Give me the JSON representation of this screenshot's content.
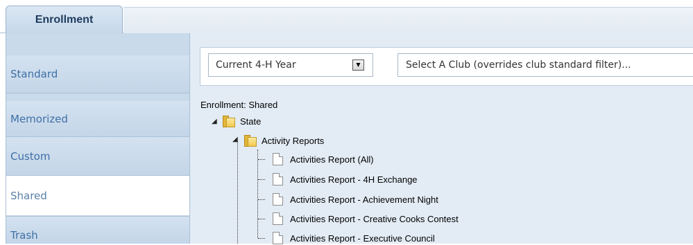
{
  "tabs": [
    {
      "label": "Enrollment",
      "active": true
    }
  ],
  "sidebar": {
    "items": [
      {
        "label": "Standard",
        "active": false
      },
      {
        "label": "Memorized",
        "active": false
      },
      {
        "label": "Custom",
        "active": false
      },
      {
        "label": "Shared",
        "active": true
      },
      {
        "label": "Trash",
        "active": false
      }
    ]
  },
  "filters": {
    "year_select": {
      "value": "Current 4-H Year"
    },
    "club_input": {
      "value": "Select A Club (overrides club standard filter)..."
    }
  },
  "tree": {
    "breadcrumb": "Enrollment: Shared",
    "root": {
      "label": "State",
      "expanded": true,
      "children": [
        {
          "label": "Activity Reports",
          "expanded": true,
          "children": [
            {
              "label": "Activities Report (All)"
            },
            {
              "label": "Activities Report - 4H Exchange"
            },
            {
              "label": "Activities Report - Achievement Night"
            },
            {
              "label": "Activities Report - Creative Cooks Contest"
            },
            {
              "label": "Activities Report - Executive Council"
            }
          ]
        }
      ]
    }
  },
  "colors": {
    "accent": "#3f6fa6",
    "sidebar_bg": "#c9daea",
    "content_bg": "#e3ecf5",
    "folder": "#f0c84e"
  },
  "icons": {
    "folder": "folder-icon",
    "document": "document-icon",
    "expanded": "expanded-triangle-icon",
    "dropdown": "dropdown-arrow-icon"
  }
}
